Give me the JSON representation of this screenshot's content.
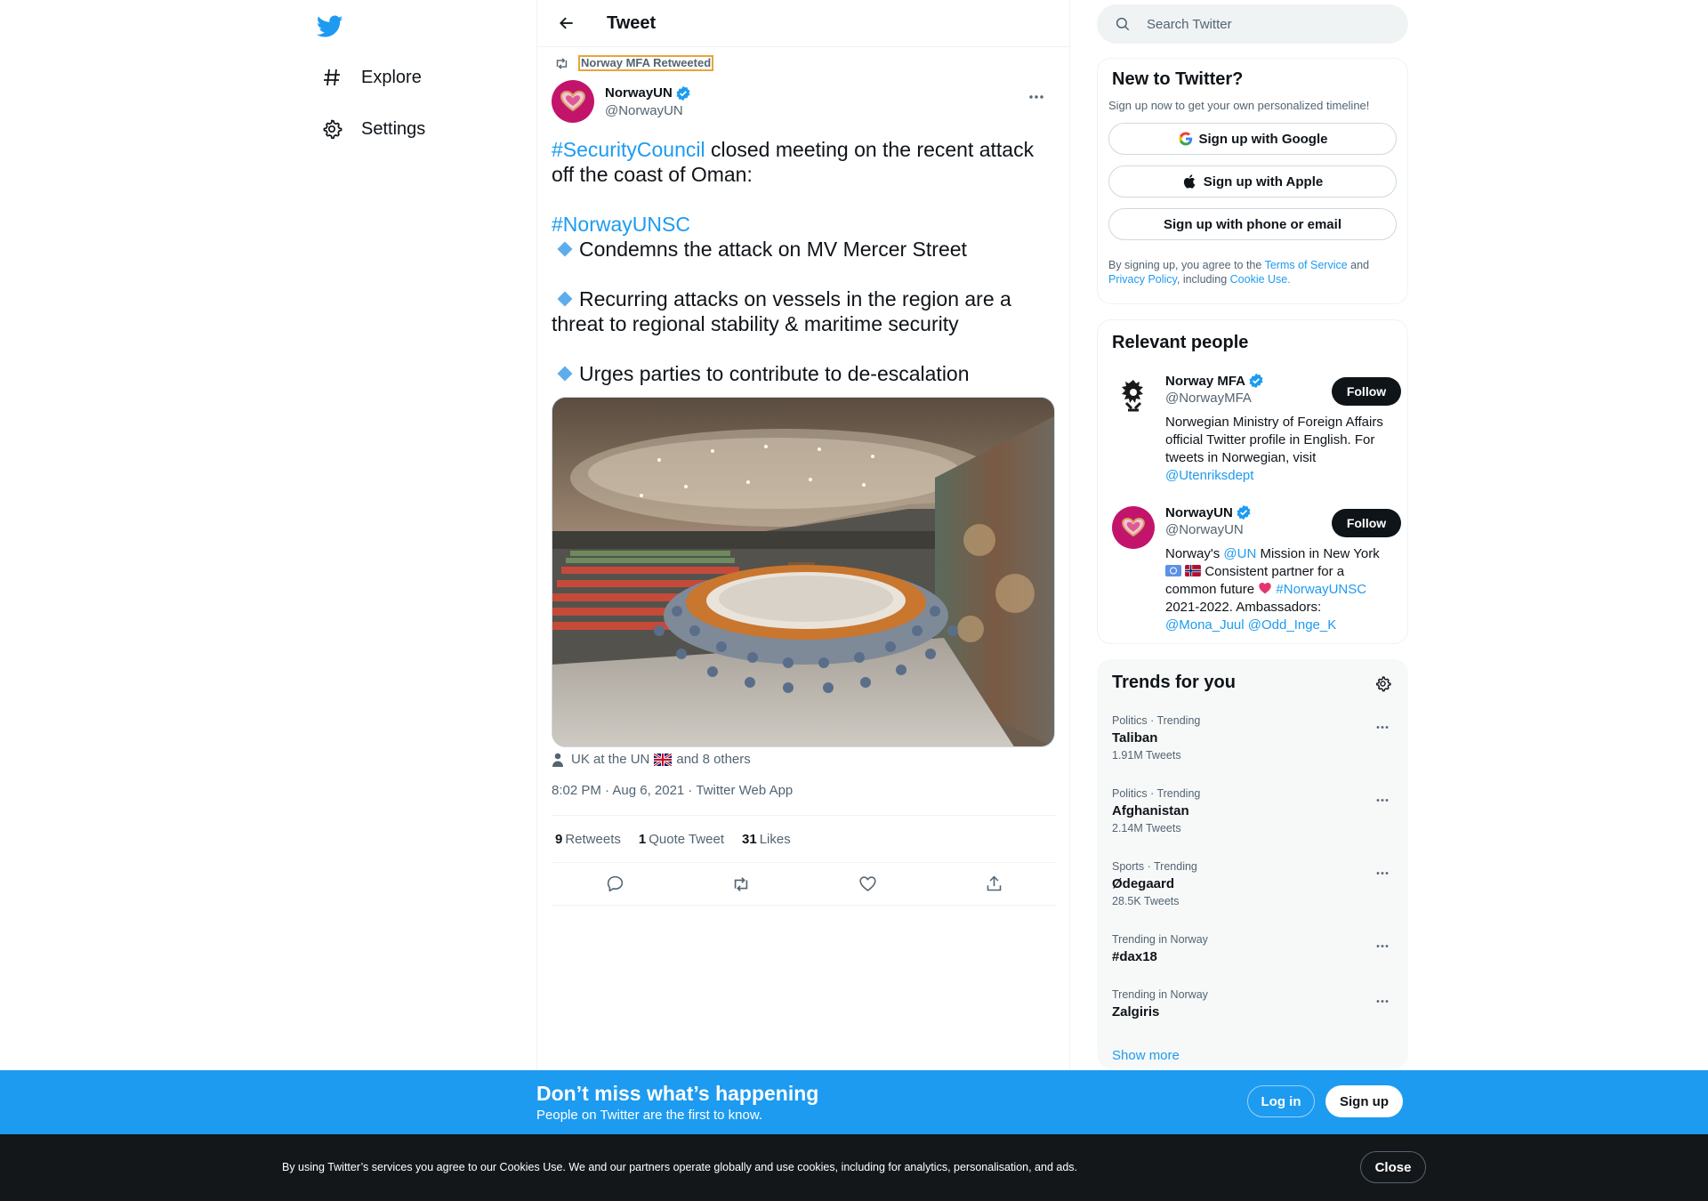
{
  "nav": {
    "items": [
      {
        "label": "Explore",
        "icon": "hashtag-icon"
      },
      {
        "label": "Settings",
        "icon": "gear-icon"
      }
    ]
  },
  "header": {
    "title": "Tweet"
  },
  "tweet": {
    "retweeted_by": "Norway MFA Retweeted",
    "author_name": "NorwayUN",
    "author_handle": "@NorwayUN",
    "text": {
      "hashtag1": "#SecurityCouncil",
      "line1_rest": " closed meeting on the recent attack off the coast of Oman:",
      "hashtag2": "#NorwayUNSC",
      "bullet1": "Condemns the attack on MV Mercer Street",
      "bullet2": "Recurring attacks on vessels in the region are a threat to regional stability & maritime security",
      "bullet3": "Urges parties to contribute to de-escalation"
    },
    "tagged_first": "UK at the UN",
    "tagged_rest": "and 8 others",
    "timestamp": "8:02 PM · Aug 6, 2021 · Twitter Web App",
    "stats": {
      "retweets_count": "9",
      "retweets_label": "Retweets",
      "quotes_count": "1",
      "quotes_label": "Quote Tweet",
      "likes_count": "31",
      "likes_label": "Likes"
    }
  },
  "search": {
    "placeholder": "Search Twitter"
  },
  "new_to_twitter": {
    "title": "New to Twitter?",
    "subtitle": "Sign up now to get your own personalized timeline!",
    "google": "Sign up with Google",
    "apple": "Sign up with Apple",
    "phone": "Sign up with phone or email",
    "terms_pre": "By signing up, you agree to the ",
    "terms_link": "Terms of Service",
    "terms_and": " and ",
    "privacy_link": "Privacy Policy",
    "terms_including": ", including ",
    "cookie_link": "Cookie Use."
  },
  "relevant_people": {
    "title": "Relevant people",
    "people": [
      {
        "name": "Norway MFA",
        "handle": "@NorwayMFA",
        "bio": "Norwegian Ministry of Foreign Affairs official Twitter profile in English. For tweets in Norwegian, visit ",
        "bio_link": "@Utenriksdept",
        "follow": "Follow"
      },
      {
        "name": "NorwayUN",
        "handle": "@NorwayUN",
        "bio_a": "Norway's ",
        "bio_link1": "@UN",
        "bio_b": " Mission in New York",
        "bio_c": " Consistent partner for a common future ",
        "bio_link2": "#NorwayUNSC",
        "bio_d": " 2021-2022. Ambassadors: ",
        "bio_link3": "@Mona_Juul",
        "bio_link4": "@Odd_Inge_K",
        "follow": "Follow"
      }
    ]
  },
  "trends": {
    "title": "Trends for you",
    "items": [
      {
        "context": "Politics · Trending",
        "name": "Taliban",
        "count": "1.91M Tweets"
      },
      {
        "context": "Politics · Trending",
        "name": "Afghanistan",
        "count": "2.14M Tweets"
      },
      {
        "context": "Sports · Trending",
        "name": "Ødegaard",
        "count": "28.5K Tweets"
      },
      {
        "context": "Trending in Norway",
        "name": "#dax18",
        "count": ""
      },
      {
        "context": "Trending in Norway",
        "name": "Zalgiris",
        "count": ""
      }
    ],
    "show_more": "Show more"
  },
  "banner": {
    "title": "Don’t miss what’s happening",
    "subtitle": "People on Twitter are the first to know.",
    "login": "Log in",
    "signup": "Sign up"
  },
  "cookie": {
    "text": "By using Twitter’s services you agree to our Cookies Use. We and our partners operate globally and use cookies, including for analytics, personalisation, and ads.",
    "close": "Close"
  },
  "colors": {
    "accent": "#1d9bf0",
    "text": "#0f1419",
    "muted": "#536471",
    "avatar_norwayun": "#c3146c",
    "cookie_bg": "#14171a"
  }
}
